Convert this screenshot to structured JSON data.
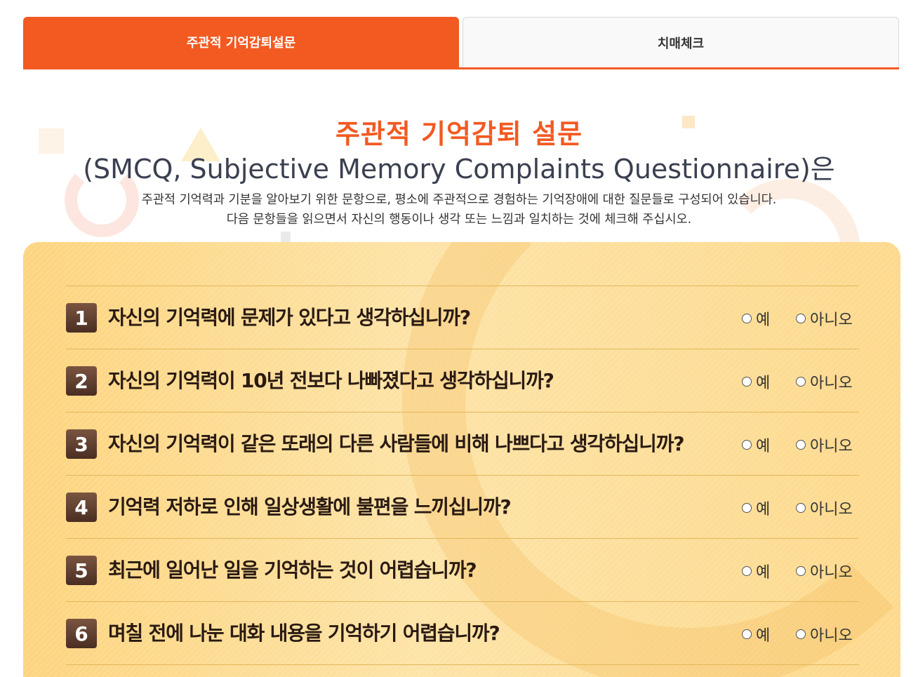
{
  "tabs": [
    {
      "label": "주관적 기억감퇴설문",
      "active": true
    },
    {
      "label": "치매체크",
      "active": false
    }
  ],
  "header": {
    "title": "주관적 기억감퇴 설문",
    "subtitle": "(SMCQ, Subjective Memory Complaints Questionnaire)은",
    "description_line1": "주관적 기억력과 기분을 알아보기 위한 문항으로, 평소에 주관적으로 경험하는 기억장애에 대한 질문들로 구성되어 있습니다.",
    "description_line2": "다음 문항들을 읽으면서 자신의 행동이나 생각 또는 느낌과 일치하는 것에 체크해 주십시오."
  },
  "options": {
    "yes": "예",
    "no": "아니오"
  },
  "questions": [
    {
      "num": "1",
      "text": "자신의 기억력에 문제가 있다고 생각하십니까?"
    },
    {
      "num": "2",
      "text": "자신의 기억력이 10년 전보다 나빠졌다고 생각하십니까?"
    },
    {
      "num": "3",
      "text": "자신의 기억력이 같은 또래의 다른 사람들에 비해 나쁘다고 생각하십니까?"
    },
    {
      "num": "4",
      "text": "기억력 저하로 인해 일상생활에 불편을 느끼십니까?"
    },
    {
      "num": "5",
      "text": "최근에 일어난 일을 기억하는 것이 어렵습니까?"
    },
    {
      "num": "6",
      "text": "며칠 전에 나눈 대화 내용을 기억하기 어렵습니까?"
    }
  ],
  "colors": {
    "accent": "#f25a22",
    "panel": "#fdd98c",
    "number_badge": "#5a3a2b"
  }
}
